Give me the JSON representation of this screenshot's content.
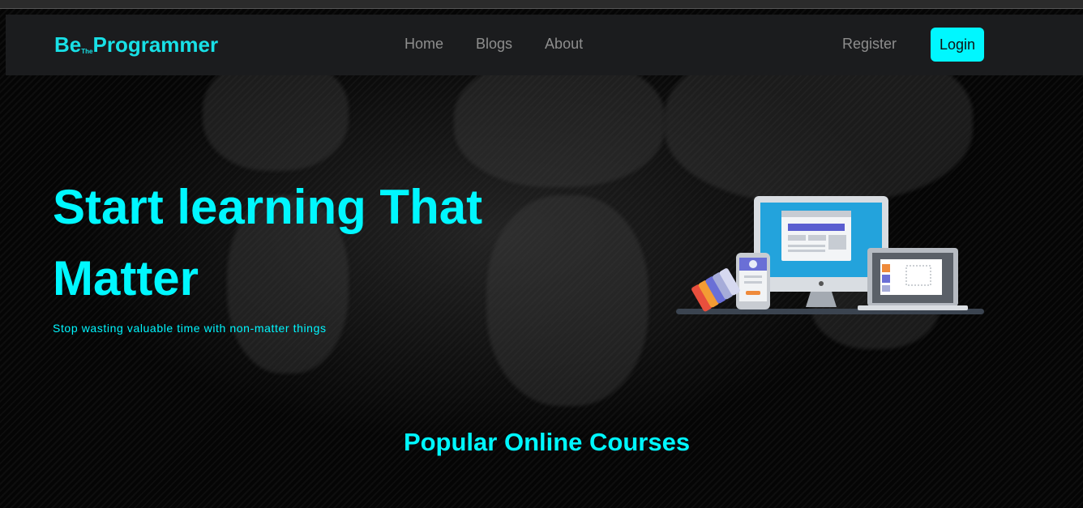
{
  "brand": {
    "part1": "Be",
    "small": "The",
    "part2": "Programmer"
  },
  "nav": {
    "items": [
      {
        "label": "Home"
      },
      {
        "label": "Blogs"
      },
      {
        "label": "About"
      }
    ],
    "register_label": "Register",
    "login_label": "Login"
  },
  "hero": {
    "title": "Start learning That Matter",
    "subtitle": "Stop wasting valuable time with non-matter things",
    "illustration": "devices-illustration"
  },
  "sections": {
    "popular_title": "Popular Online Courses"
  },
  "colors": {
    "accent": "#00f7ff",
    "navbar_bg": "#1b1c1e",
    "nav_text": "#8e8e8e",
    "page_bg": "#050505"
  }
}
